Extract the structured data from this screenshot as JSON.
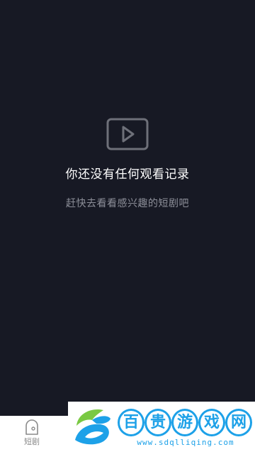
{
  "empty_state": {
    "icon": "play-video-icon",
    "title": "你还没有任何观看记录",
    "subtitle": "赶快去看看感兴趣的短剧吧"
  },
  "bottom_nav": {
    "items": [
      {
        "label": "短剧",
        "icon": "short-drama-icon"
      }
    ]
  },
  "watermark": {
    "chars": [
      "百",
      "贵",
      "游",
      "戏",
      "网"
    ],
    "url": "www.sdqlliqing.com"
  },
  "colors": {
    "background": "#171924",
    "title": "#ffffff",
    "subtitle": "#8d8f99",
    "icon_stroke": "#6e7079",
    "watermark_blue": "#1da1e8",
    "watermark_green": "#7ac943"
  }
}
